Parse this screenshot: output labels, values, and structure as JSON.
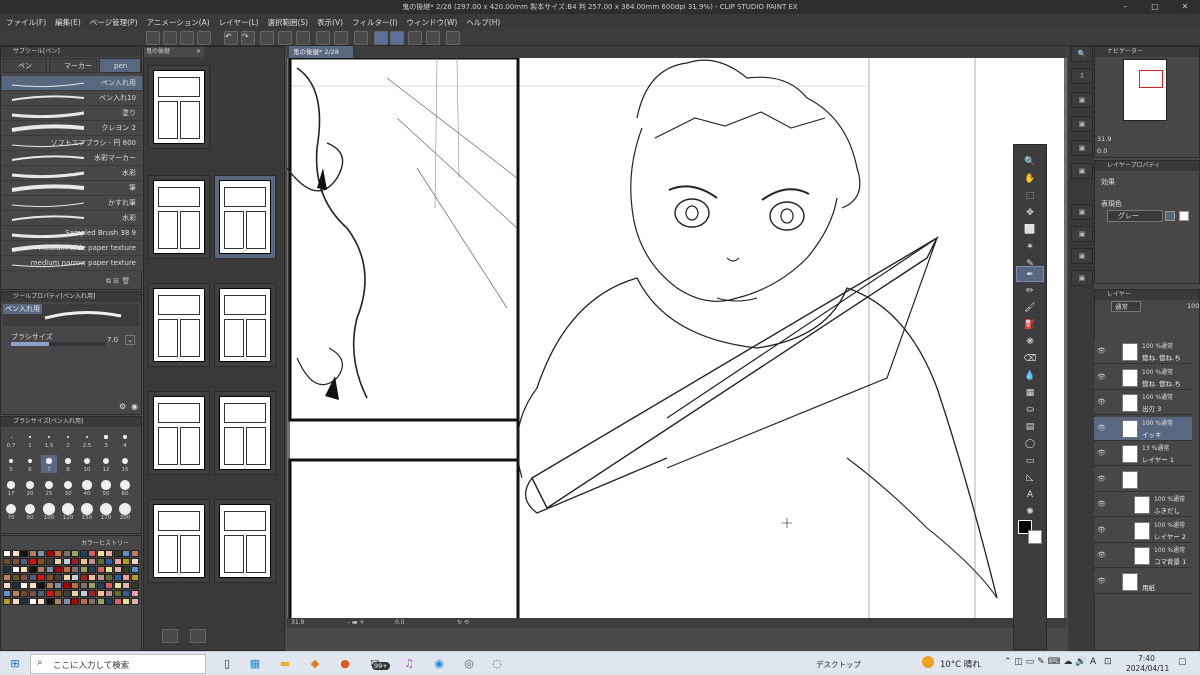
{
  "window": {
    "title": "鬼の後継* 2/28 (297.00 x 420.00mm 製本サイズ:B4 判 257.00 x 364.00mm 600dpi 31.9%) - CLIP STUDIO PAINT EX"
  },
  "menu": [
    "ファイル(F)",
    "編集(E)",
    "ページ管理(P)",
    "アニメーション(A)",
    "レイヤー(L)",
    "選択範囲(S)",
    "表示(V)",
    "フィルター(I)",
    "ウィンドウ(W)",
    "ヘルプ(H)"
  ],
  "sub_tool": {
    "header": "サブツール[ペン]",
    "tabs": [
      "ペン",
      "マーカー",
      "pen"
    ],
    "brushes": [
      "ペン入れ用",
      "ペン入れ10",
      "塗り",
      "クレヨン 2",
      "ソフトエアブラシ - 円 800",
      "水彩マーカー",
      "水彩",
      "筆",
      "かすれ筆",
      "水彩",
      "Sampled Brush 38 9",
      "medium wide paper texture",
      "medium narrow paper texture"
    ]
  },
  "tool_property": {
    "header": "ツールプロパティ[ペン入れ用]",
    "preset": "ペン入れ用",
    "brush_size_label": "ブラシサイズ",
    "brush_size_value": "7.0"
  },
  "brush_size_palette": {
    "header": "ブラシサイズ[ペン入れ用]",
    "sizes": [
      "0.7",
      "1",
      "1.5",
      "2",
      "2.5",
      "3",
      "4",
      "5",
      "6",
      "7",
      "8",
      "10",
      "12",
      "15",
      "17",
      "20",
      "25",
      "30",
      "40",
      "50",
      "60",
      "70",
      "80",
      "100",
      "120",
      "150",
      "170",
      "200"
    ],
    "selected": "7"
  },
  "color_history": {
    "header": "カラーヒストリー"
  },
  "page_manager": {
    "tab": "鬼の後継",
    "pages": [
      {
        "label": "1",
        "selected": false
      },
      {
        "label": "3",
        "selected": false
      },
      {
        "label": "2*",
        "selected": true
      },
      {
        "label": "5",
        "selected": false
      },
      {
        "label": "4",
        "selected": false
      },
      {
        "label": "7",
        "selected": false
      },
      {
        "label": "6",
        "selected": false
      },
      {
        "label": "9",
        "selected": false
      },
      {
        "label": "8",
        "selected": false
      }
    ]
  },
  "canvas": {
    "tab": "鬼の後継* 2/28",
    "zoom": "31.9",
    "rotation": "0.0"
  },
  "navigator": {
    "header": "ナビゲーター",
    "zoom": "31.9",
    "angle": "0.0"
  },
  "layer_property": {
    "header": "レイヤープロパティ",
    "effect_label": "効果",
    "expression_label": "表現色",
    "expression_value": "グレー"
  },
  "layer_panel": {
    "header": "レイヤー",
    "blend_mode": "通常",
    "opacity": "100",
    "layers": [
      {
        "line1": "100 %通常",
        "line2": "惚ね. 惚ね.ち",
        "selected": false
      },
      {
        "line1": "100 %通常",
        "line2": "惚ね. 惚ね.ち",
        "selected": false
      },
      {
        "line1": "100 %通常",
        "line2": "出刃 3",
        "selected": false
      },
      {
        "line1": "100 %通常",
        "line2": "イッキ",
        "selected": true
      },
      {
        "line1": "13 %通常",
        "line2": "レイヤー 1",
        "selected": false
      },
      {
        "line1": "",
        "line2": "",
        "selected": false
      },
      {
        "line1": "100 %通常",
        "line2": "ふきだし",
        "selected": false
      },
      {
        "line1": "100 %通常",
        "line2": "レイヤー 2",
        "selected": false
      },
      {
        "line1": "100 %通常",
        "line2": "コマ背景 1",
        "selected": false
      },
      {
        "line1": "",
        "line2": "用紙",
        "selected": false
      }
    ]
  },
  "taskbar": {
    "search_placeholder": "ここに入力して検索",
    "badge": "99+",
    "desktop": "デスクトップ",
    "weather": "10°C 晴れ",
    "ime": "A",
    "time": "7:40",
    "date": "2024/04/11"
  },
  "colors": {
    "accent": "#5a6781",
    "panel": "#474747",
    "dark": "#2e2e2e",
    "canvas": "#ffffff"
  }
}
